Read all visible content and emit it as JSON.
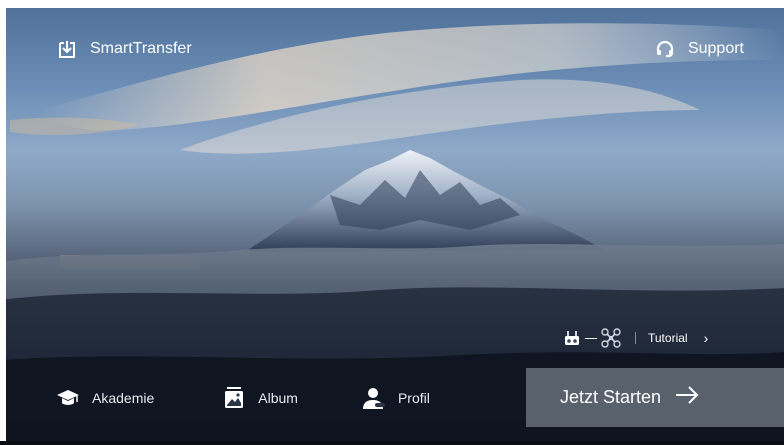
{
  "header": {
    "smarttransfer_label": "SmartTransfer",
    "support_label": "Support"
  },
  "tutorial": {
    "label": "Tutorial"
  },
  "nav": {
    "akademie_label": "Akademie",
    "album_label": "Album",
    "profil_label": "Profil"
  },
  "start": {
    "label": "Jetzt Starten"
  },
  "icons": {
    "smarttransfer": "download-icon",
    "support": "headset-icon",
    "remote_controller": "remote-controller-icon",
    "drone": "drone-icon",
    "akademie": "graduation-cap-icon",
    "album": "album-icon",
    "profil": "user-icon",
    "arrow": "arrow-right-icon",
    "chevron": "chevron-right-icon"
  },
  "colors": {
    "start_button_bg": "#96a0ac",
    "text": "#ffffff"
  }
}
